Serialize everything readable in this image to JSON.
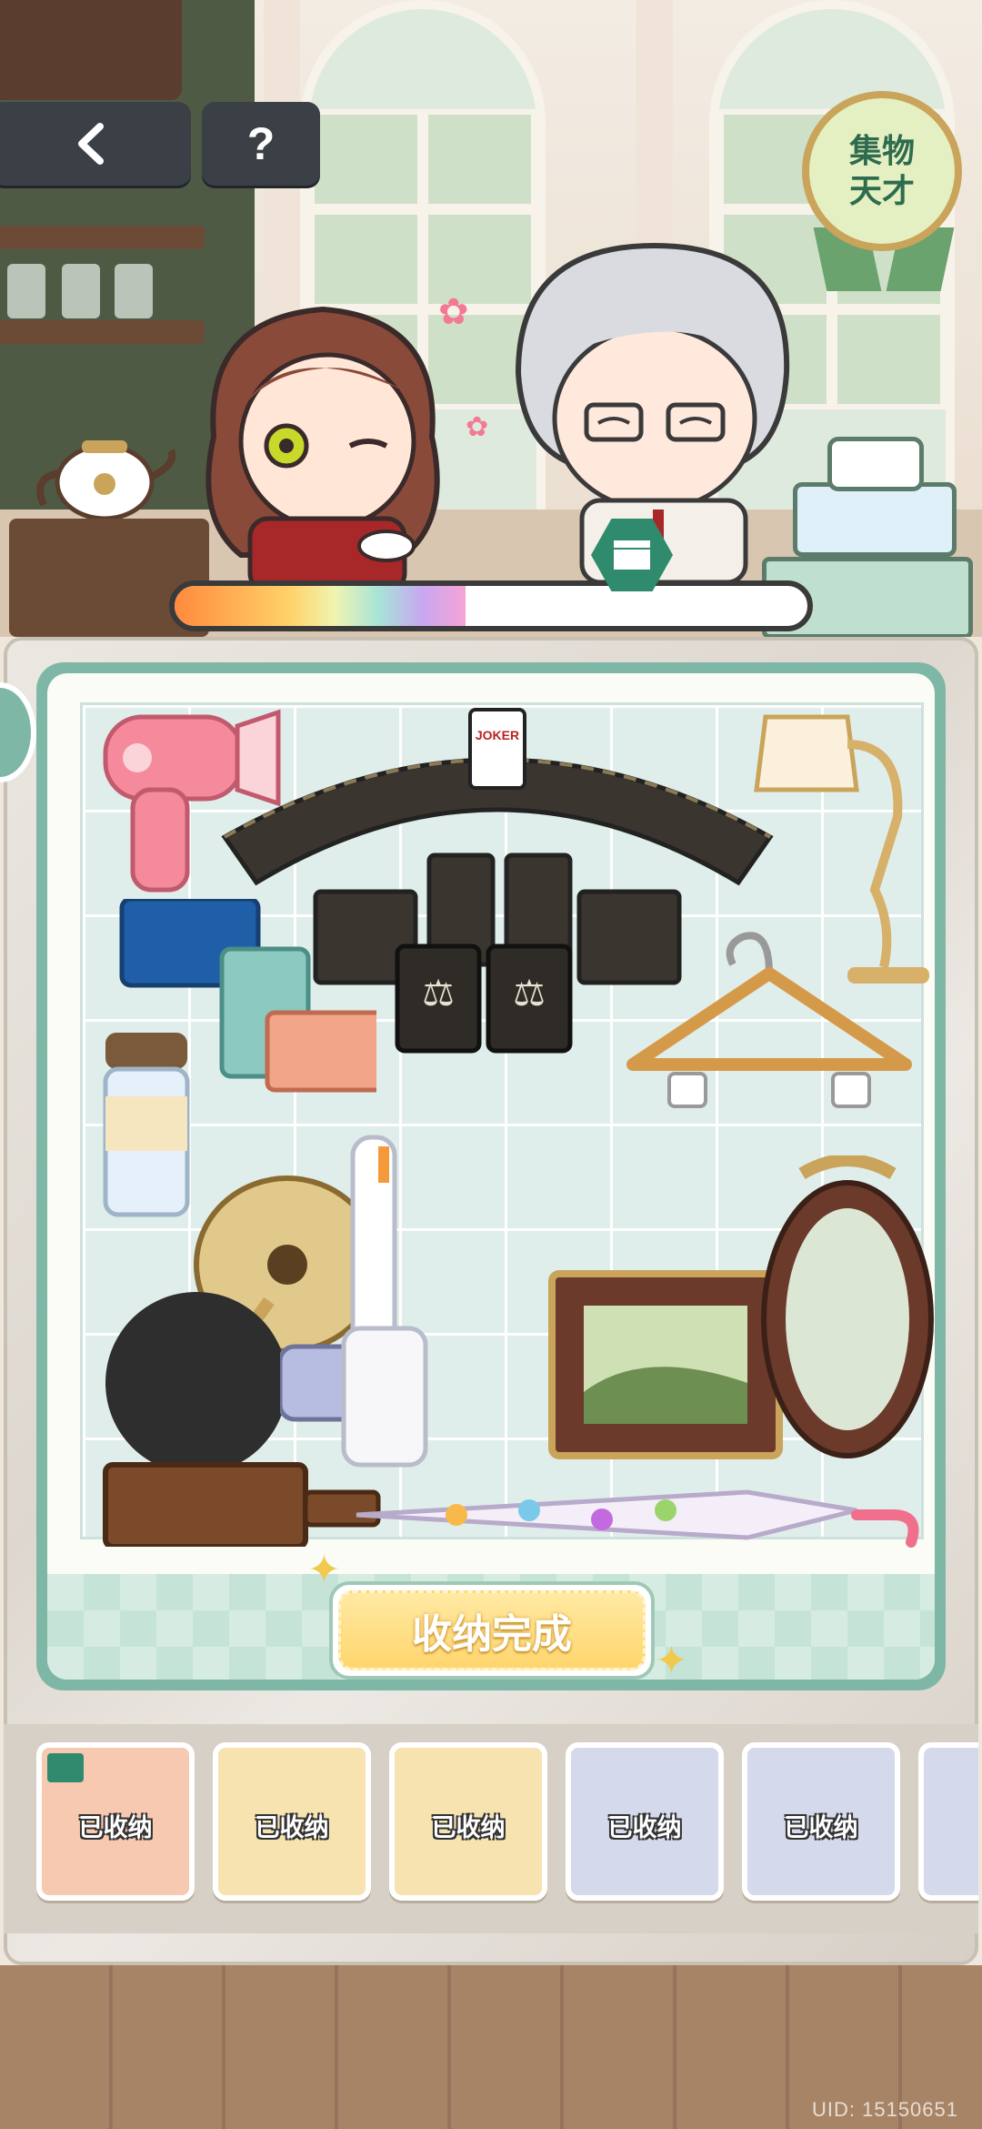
{
  "header": {
    "help_label": "?",
    "badge_text": "集物\n天才"
  },
  "progress": {
    "fraction": 0.46
  },
  "board": {
    "cards_label": "JOKER",
    "done_button": "收纳完成"
  },
  "inventory": {
    "items": [
      {
        "label": "已收纳",
        "bg": "#f6c9b0"
      },
      {
        "label": "已收纳",
        "bg": "#f7e3b0"
      },
      {
        "label": "已收纳",
        "bg": "#f7e3b0"
      },
      {
        "label": "已收纳",
        "bg": "#d4d9ec"
      },
      {
        "label": "已收纳",
        "bg": "#d4d9ec"
      }
    ]
  },
  "footer": {
    "uid": "UID: 15150651"
  },
  "colors": {
    "accent": "#2f8a6e",
    "button": "#ffd66e",
    "board": "#7fb7a6"
  }
}
